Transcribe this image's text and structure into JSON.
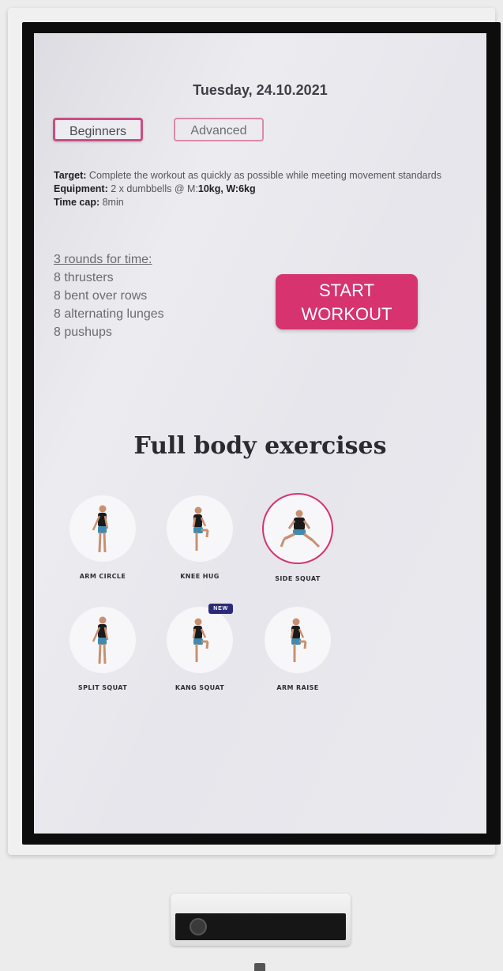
{
  "header": {
    "date": "Tuesday, 24.10.2021"
  },
  "tabs": [
    {
      "label": "Beginners",
      "selected": true
    },
    {
      "label": "Advanced",
      "selected": false
    }
  ],
  "workout_info": {
    "target_label": "Target:",
    "target_text": "Complete the workout as quickly as possible while meeting movement standards",
    "equipment_label": "Equipment:",
    "equipment_text": "2 x dumbbells @ M:",
    "equipment_weights": "10kg, W:6kg",
    "timecap_label": "Time cap:",
    "timecap_text": "8min"
  },
  "routine": {
    "header": "3 rounds for time:",
    "items": [
      "8 thrusters",
      "8 bent over rows",
      "8 alternating lunges",
      "8 pushups"
    ]
  },
  "start_button": {
    "line1": "START",
    "line2": "WORKOUT"
  },
  "exercises_section": {
    "title": "Full body exercises",
    "items": [
      {
        "label": "ARM CIRCLE",
        "pose": "standing-arm",
        "selected": false,
        "badge": ""
      },
      {
        "label": "KNEE HUG",
        "pose": "knee-raise",
        "selected": false,
        "badge": ""
      },
      {
        "label": "SIDE SQUAT",
        "pose": "side-squat",
        "selected": true,
        "badge": ""
      },
      {
        "label": "SPLIT SQUAT",
        "pose": "standing-arm",
        "selected": false,
        "badge": ""
      },
      {
        "label": "KANG SQUAT",
        "pose": "knee-raise",
        "selected": false,
        "badge": "NEW"
      },
      {
        "label": "ARM RAISE",
        "pose": "knee-raise",
        "selected": false,
        "badge": ""
      }
    ]
  },
  "colors": {
    "accent": "#d6336f",
    "badge": "#2b2a7a",
    "shirt": "#1a1a1a",
    "shorts": "#3f8bb0",
    "skin": "#c89070"
  }
}
